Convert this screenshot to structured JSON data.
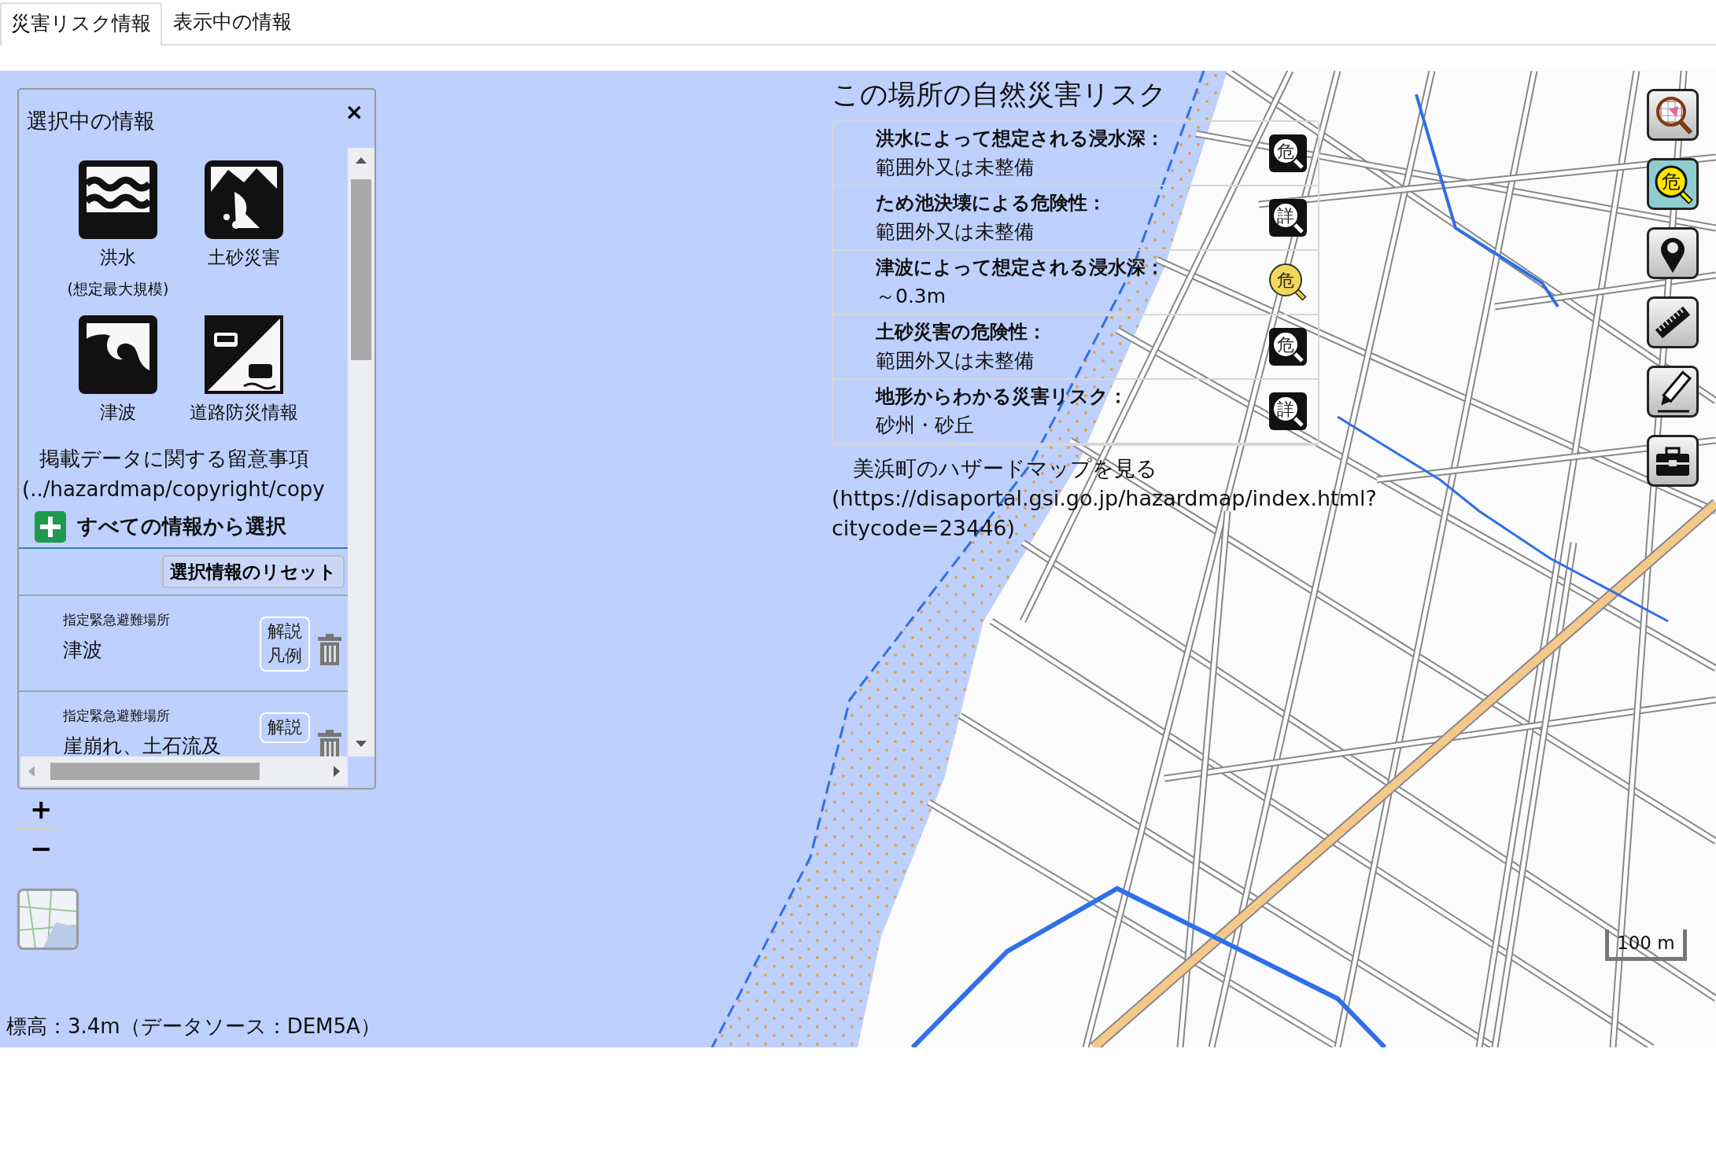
{
  "tabs": [
    {
      "label": "災害リスク情報",
      "selected": true
    },
    {
      "label": "表示中の情報",
      "selected": false
    }
  ],
  "selection_panel": {
    "title": "選択中の情報",
    "close": "×",
    "categories": [
      {
        "kind": "flood",
        "label": "洪水",
        "note": "(想定最大規模)"
      },
      {
        "kind": "landslide",
        "label": "土砂災害"
      },
      {
        "kind": "tsunami",
        "label": "津波"
      },
      {
        "kind": "road",
        "label": "道路防災情報"
      }
    ],
    "notice": "掲載データに関する留意事項",
    "notice_link": "(../hazardmap/copyright/copy",
    "add_all": "すべての情報から選択",
    "reset_button": "選択情報のリセット",
    "layers": [
      {
        "category": "指定緊急避難場所",
        "name": "津波",
        "legend_button": [
          "解説",
          "凡例"
        ]
      },
      {
        "category": "指定緊急避難場所",
        "name": "崖崩れ、土石流及",
        "legend_button": [
          "解説"
        ]
      }
    ]
  },
  "zoom": {
    "zoom_in": "+",
    "zoom_out": "−"
  },
  "elevation": "標高：3.4m（データソース：DEM5A）",
  "risk_panel": {
    "title": "この場所の自然災害リスク",
    "rows": [
      {
        "label": "洪水によって想定される浸水深：",
        "value": "範囲外又は未整備",
        "icon": "危",
        "highlighted": false
      },
      {
        "label": "ため池決壊による危険性：",
        "value": "範囲外又は未整備",
        "icon": "詳",
        "highlighted": false
      },
      {
        "label": "津波によって想定される浸水深：",
        "value": "～0.3m",
        "icon": "危",
        "highlighted": true
      },
      {
        "label": "土砂災害の危険性：",
        "value": "範囲外又は未整備",
        "icon": "危",
        "highlighted": false
      },
      {
        "label": "地形からわかる災害リスク：",
        "value": "砂州・砂丘",
        "icon": "詳",
        "highlighted": false
      }
    ],
    "hazard_map_link": "美浜町のハザードマップを見る(https://disaportal.gsi.go.jp/hazardmap/index.html?citycode=23446)"
  },
  "toolbar": [
    {
      "kind": "layer-search",
      "selected": false
    },
    {
      "kind": "hazard-search",
      "glyph": "危",
      "selected": true
    },
    {
      "kind": "pin",
      "selected": false
    },
    {
      "kind": "ruler",
      "selected": false
    },
    {
      "kind": "pencil",
      "selected": false
    },
    {
      "kind": "toolbox",
      "selected": false
    }
  ],
  "scale_bar": "100 m"
}
